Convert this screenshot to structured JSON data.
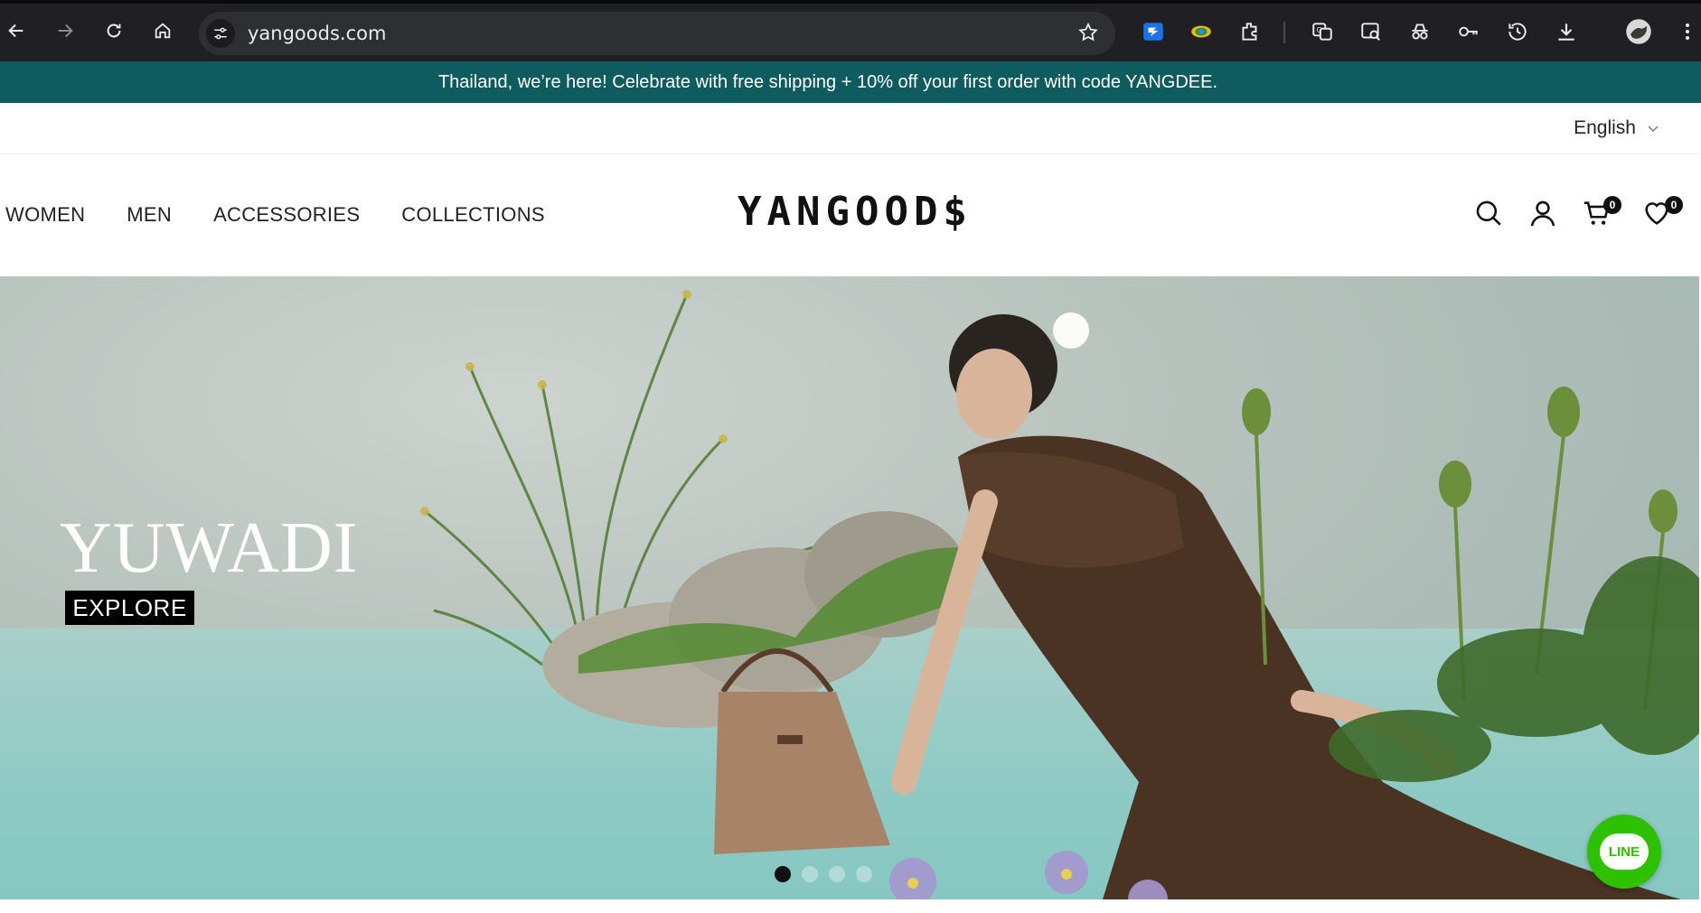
{
  "browser": {
    "url": "yangoods.com",
    "accent": "#1f1f24"
  },
  "promo": {
    "text": "Thailand, we’re here! Celebrate with free shipping + 10% off your first order with code YANGDEE.",
    "bg": "#0e5b60"
  },
  "language": {
    "selected": "English"
  },
  "header": {
    "nav": [
      "WOMEN",
      "MEN",
      "ACCESSORIES",
      "COLLECTIONS"
    ],
    "logo": "YANGOOD$",
    "cart_count": "0",
    "wishlist_count": "0"
  },
  "hero": {
    "title": "YUWADI",
    "button": "EXPLORE",
    "slide_current": 1,
    "slide_total": 4
  },
  "chat": {
    "label": "LINE",
    "color": "#2dc100"
  }
}
